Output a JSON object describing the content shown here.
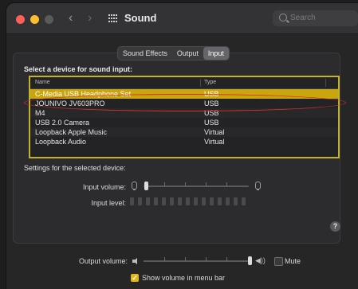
{
  "window": {
    "title": "Sound",
    "search_placeholder": "Search"
  },
  "nav": {
    "back": "‹",
    "forward": "›"
  },
  "tabs": [
    {
      "label": "Sound Effects",
      "selected": false
    },
    {
      "label": "Output",
      "selected": false
    },
    {
      "label": "Input",
      "selected": true
    }
  ],
  "input": {
    "select_label": "Select a device for sound input:",
    "columns": {
      "name": "Name",
      "type": "Type"
    },
    "devices": [
      {
        "name": "C-Media USB Headphone Set",
        "type": "USB",
        "selected": true
      },
      {
        "name": "JOUNIVO JV603PRO",
        "type": "USB",
        "selected": false
      },
      {
        "name": "M4",
        "type": "USB",
        "selected": false
      },
      {
        "name": "USB 2.0 Camera",
        "type": "USB",
        "selected": false
      },
      {
        "name": "Loopback Apple Music",
        "type": "Virtual",
        "selected": false
      },
      {
        "name": "Loopback Audio",
        "type": "Virtual",
        "selected": false
      }
    ],
    "settings_label": "Settings for the selected device:",
    "input_volume_label": "Input volume:",
    "input_volume": 0,
    "input_level_label": "Input level:",
    "input_level_segments": 15,
    "input_level_active": 0
  },
  "help": "?",
  "output": {
    "volume_label": "Output volume:",
    "volume": 1.0,
    "mute_label": "Mute",
    "mute_checked": false,
    "show_volume_label": "Show volume in menu bar",
    "show_volume_checked": true,
    "check_glyph": "✓"
  },
  "colors": {
    "selected_row": "#c9a60e",
    "highlight_frame": "#c2b22c",
    "annotation_oval": "#d9322b"
  }
}
